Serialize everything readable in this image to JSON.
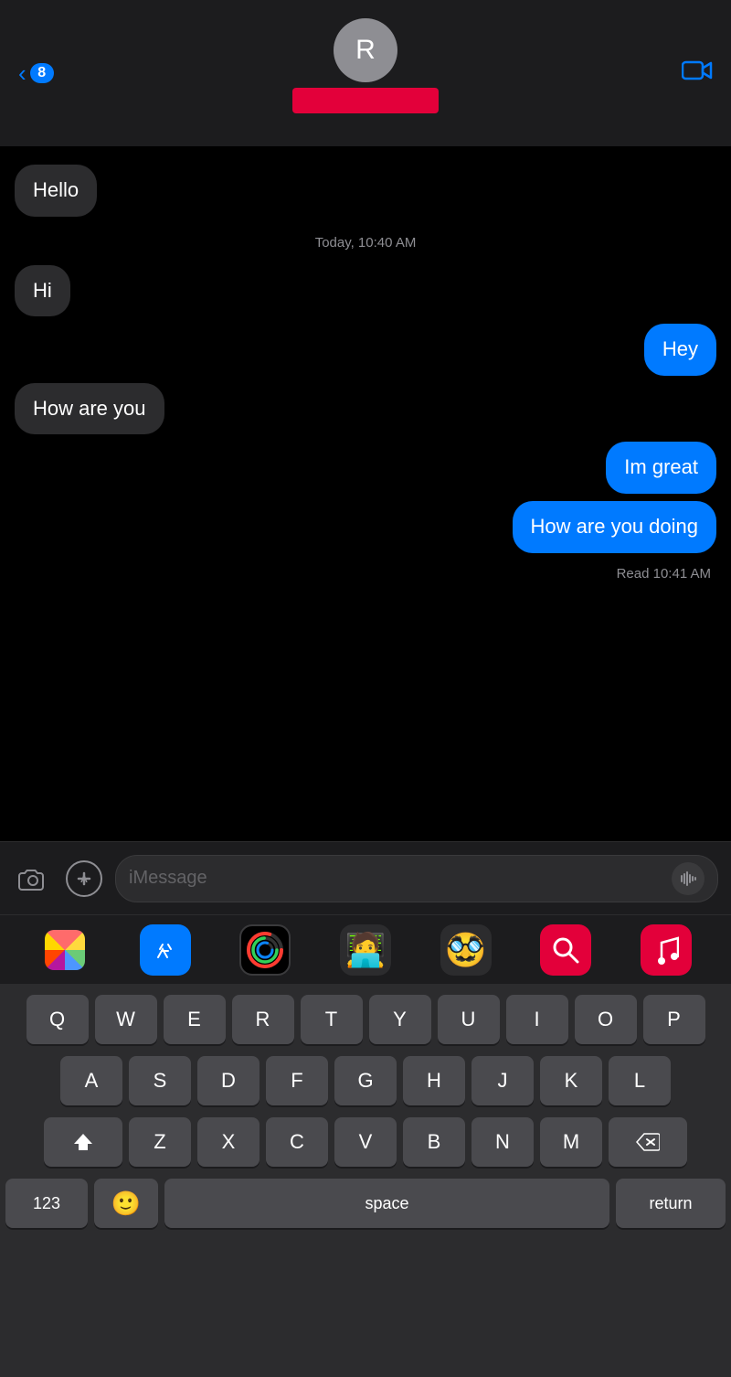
{
  "header": {
    "back_count": "8",
    "avatar_initial": "R",
    "video_icon": "📹"
  },
  "messages": [
    {
      "id": 1,
      "type": "received",
      "text": "Hello"
    },
    {
      "id": 2,
      "type": "timestamp",
      "text": "Today, 10:40 AM"
    },
    {
      "id": 3,
      "type": "received",
      "text": "Hi"
    },
    {
      "id": 4,
      "type": "sent",
      "text": "Hey"
    },
    {
      "id": 5,
      "type": "received",
      "text": "How are you"
    },
    {
      "id": 6,
      "type": "sent",
      "text": "Im great"
    },
    {
      "id": 7,
      "type": "sent",
      "text": "How are you doing"
    }
  ],
  "read_receipt": "Read 10:41 AM",
  "input": {
    "placeholder": "iMessage"
  },
  "keyboard": {
    "rows": [
      [
        "Q",
        "W",
        "E",
        "R",
        "T",
        "Y",
        "U",
        "I",
        "O",
        "P"
      ],
      [
        "A",
        "S",
        "D",
        "F",
        "G",
        "H",
        "J",
        "K",
        "L"
      ],
      [
        "Z",
        "X",
        "C",
        "V",
        "B",
        "N",
        "M"
      ]
    ],
    "space_label": "space",
    "return_label": "return",
    "numbers_label": "123"
  }
}
